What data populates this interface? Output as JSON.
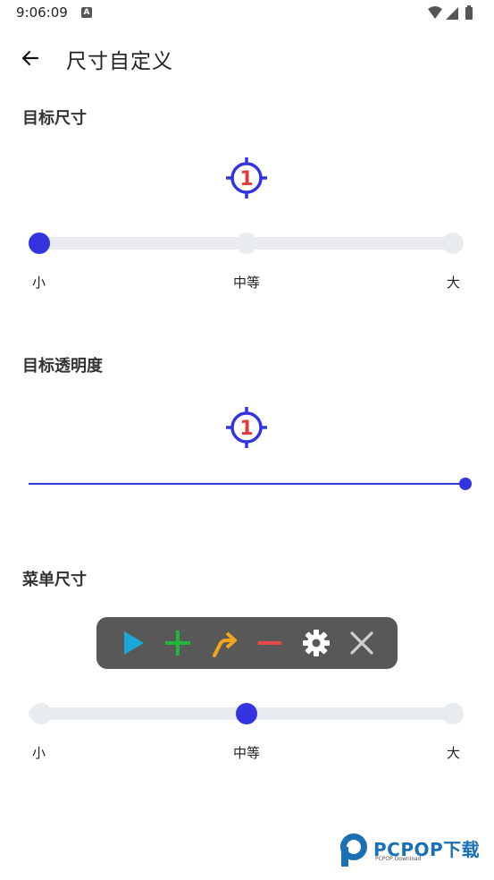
{
  "status": {
    "time": "9:06:09",
    "notif_letter": "A"
  },
  "appbar": {
    "title": "尺寸自定义"
  },
  "sections": {
    "target_size": {
      "title": "目标尺寸",
      "labels": [
        "小",
        "中等",
        "大"
      ],
      "selected_index": 0
    },
    "target_opacity": {
      "title": "目标透明度",
      "value_percent": 100
    },
    "menu_size": {
      "title": "菜单尺寸",
      "labels": [
        "小",
        "中等",
        "大"
      ],
      "selected_index": 1
    }
  },
  "target_icon": {
    "number": "1",
    "ring_color": "#3333e0",
    "number_color": "#e03a3a"
  },
  "menu_buttons": [
    {
      "name": "play-icon",
      "color": "#1aa8d8"
    },
    {
      "name": "plus-icon",
      "color": "#1eb83a"
    },
    {
      "name": "swipe-arrow-icon",
      "color": "#f0a81a"
    },
    {
      "name": "minus-icon",
      "color": "#e84848"
    },
    {
      "name": "gear-icon",
      "color": "#ffffff"
    },
    {
      "name": "close-icon",
      "color": "#d0d0d0"
    }
  ],
  "watermark": {
    "brand": "PCPOP下载",
    "sub": "PCPOP Download"
  }
}
